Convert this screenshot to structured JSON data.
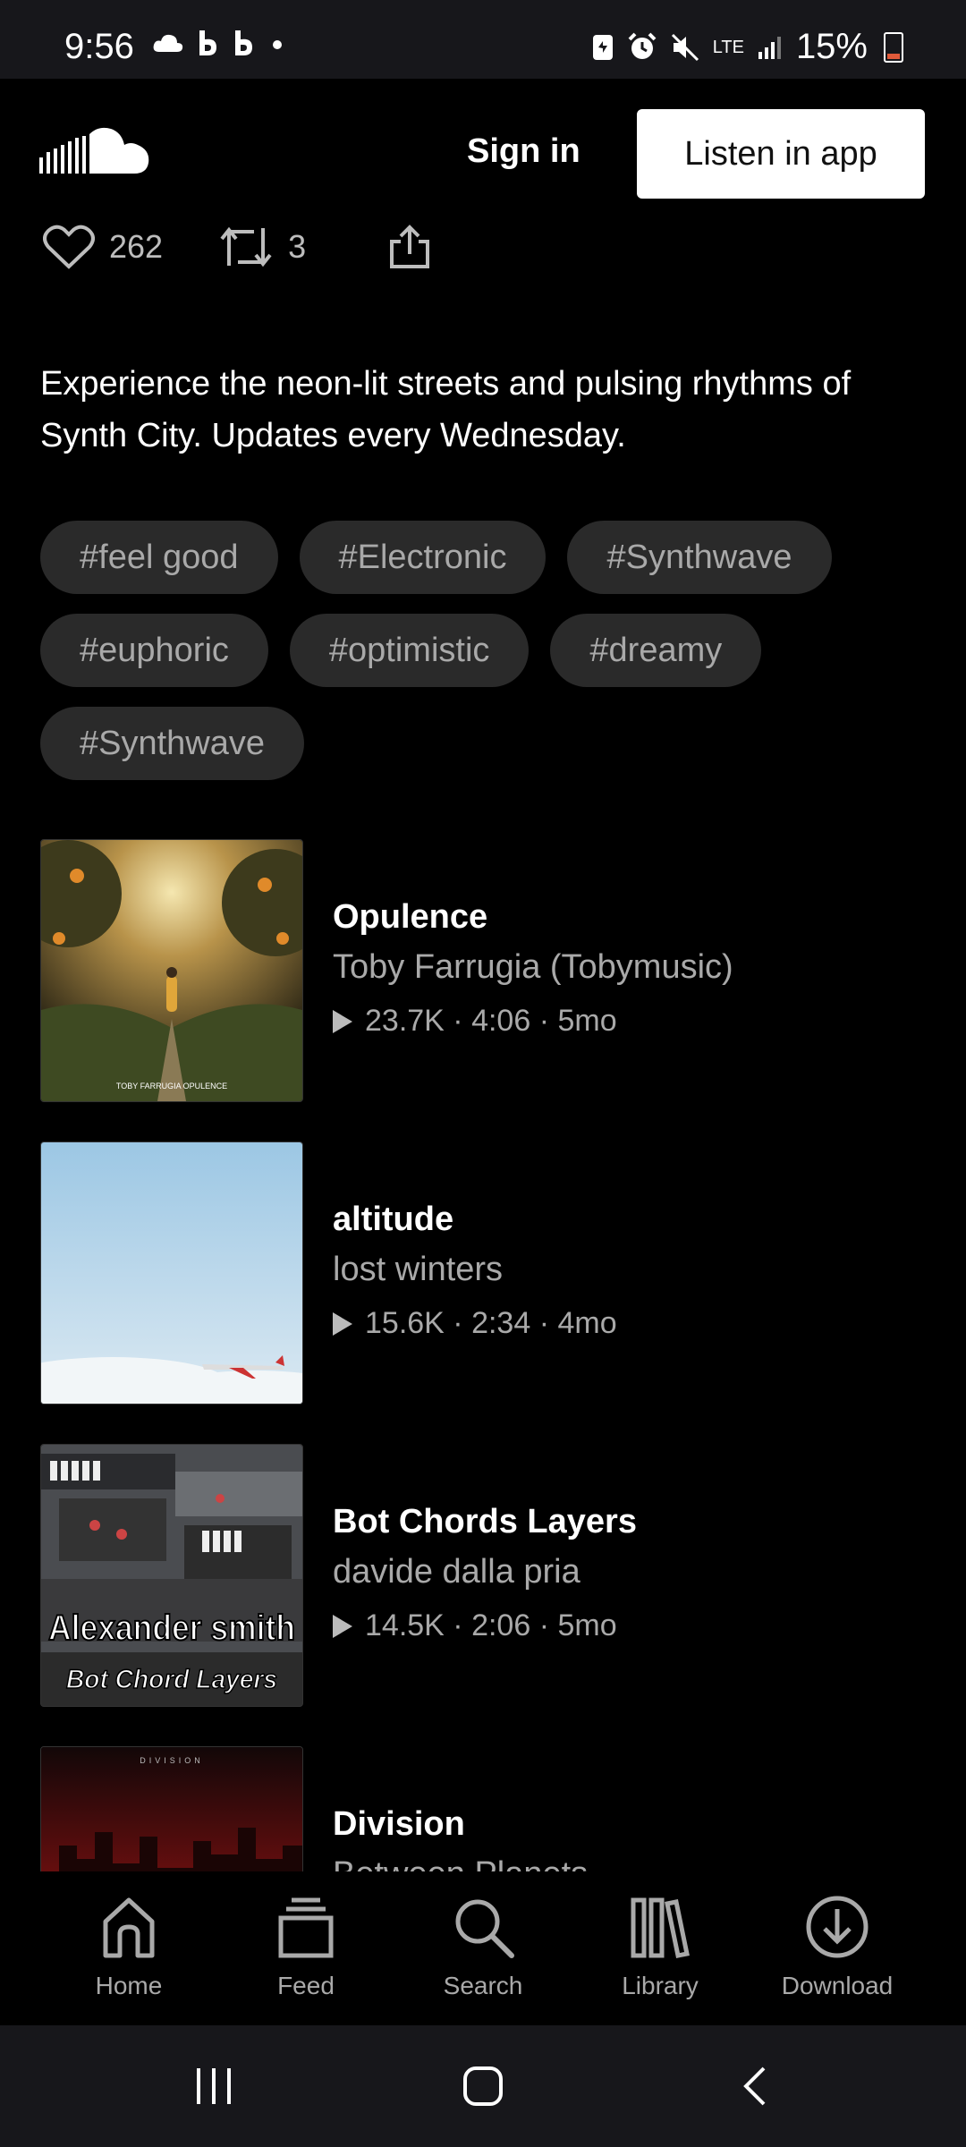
{
  "status_bar": {
    "time": "9:56",
    "network": "LTE",
    "battery": "15%",
    "icons": [
      "cloud-icon",
      "b-app-icon",
      "b-app-icon",
      "dot-icon",
      "sync-icon",
      "alarm-icon",
      "mute-icon",
      "signal-icon",
      "battery-icon"
    ]
  },
  "header": {
    "logo": "soundcloud-logo",
    "sign_in": "Sign in",
    "listen_in_app": "Listen in app"
  },
  "actions": {
    "likes": "262",
    "reposts": "3"
  },
  "description": "Experience the neon-lit streets and pulsing rhythms of Synth City. Updates every Wednesday.",
  "tags": [
    "#feel good",
    "#Electronic",
    "#Synthwave",
    "#euphoric",
    "#optimistic",
    "#dreamy",
    "#Synthwave"
  ],
  "tracks": [
    {
      "title": "Opulence",
      "artist": "Toby Farrugia (Tobymusic)",
      "plays": "23.7K",
      "duration": "4:06",
      "age": "5mo",
      "art_text": "TOBY FARRUGIA OPULENCE"
    },
    {
      "title": "altitude",
      "artist": "lost winters",
      "plays": "15.6K",
      "duration": "2:34",
      "age": "4mo"
    },
    {
      "title": "Bot Chords Layers",
      "artist": "davide dalla pria",
      "plays": "14.5K",
      "duration": "2:06",
      "age": "5mo",
      "art_line1": "Alexander smith",
      "art_line2": "Bot Chord Layers"
    },
    {
      "title": "Division",
      "artist": "Between Planets",
      "art_text": "DIVISION"
    }
  ],
  "bottom_nav": [
    {
      "label": "Home",
      "icon": "home-icon"
    },
    {
      "label": "Feed",
      "icon": "feed-icon"
    },
    {
      "label": "Search",
      "icon": "search-icon"
    },
    {
      "label": "Library",
      "icon": "library-icon"
    },
    {
      "label": "Download",
      "icon": "download-icon"
    }
  ],
  "colors": {
    "background": "#000000",
    "tag_bg": "#2a2a2a",
    "muted_text": "#a9a9a9",
    "system_bar": "#17171b"
  }
}
